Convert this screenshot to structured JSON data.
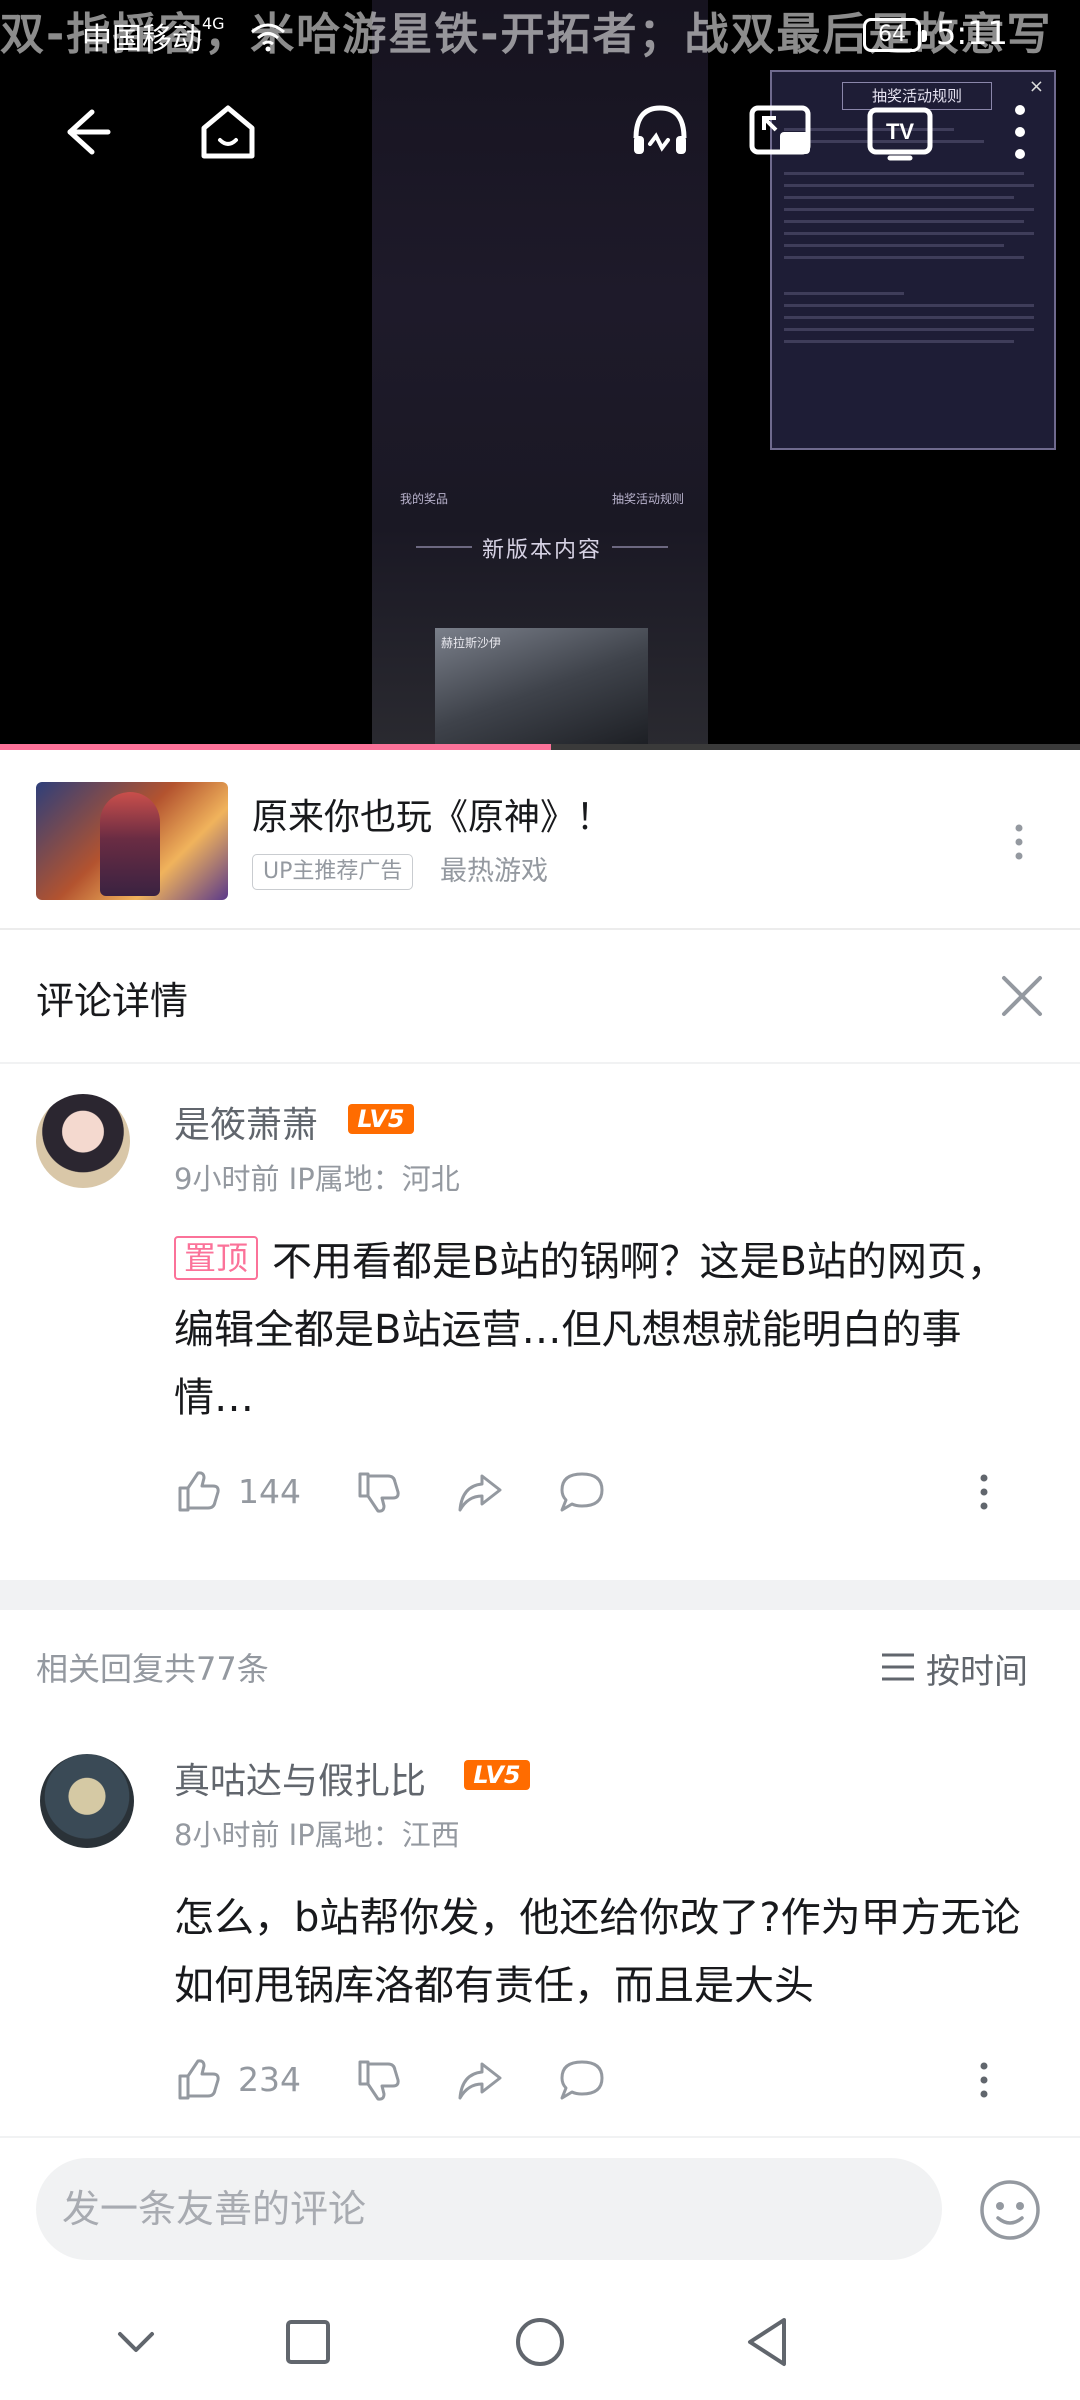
{
  "status_bar": {
    "marquee": "双-指摇容，米哈游星铁-开拓者；战双最后是故意写",
    "carrier": "中国移动",
    "network": "4G",
    "battery": "64",
    "time": "5:11"
  },
  "video": {
    "icons": [
      "back-icon",
      "home-icon",
      "audio-icon",
      "pip-icon",
      "tv-cast-icon",
      "more-icon"
    ],
    "frame": {
      "dialog_title": "抽奖活动规则",
      "my_prize_label": "我的奖品",
      "rules_label": "抽奖活动规则",
      "new_version_label": "新版本内容",
      "thumb_label": "赫拉斯沙伊"
    },
    "progress": 0.51
  },
  "ad": {
    "title": "原来你也玩《原神》！",
    "tag": "UP主推荐广告",
    "source": "最热游戏"
  },
  "comment_detail": {
    "title": "评论详情"
  },
  "main_comment": {
    "username": "是筱萧萧",
    "level": "LV5",
    "time": "9小时前",
    "ip": "IP属地：河北",
    "pinned_label": "置顶",
    "text": "不用看都是B站的锅啊？这是B站的网页，编辑全都是B站运营…但凡想想就能明白的事情…",
    "likes": "144"
  },
  "replies": {
    "header": "相关回复共77条",
    "sort_label": "按时间",
    "items": [
      {
        "username": "真咕达与假扎比",
        "level": "LV5",
        "time": "8小时前",
        "ip": "IP属地：江西",
        "text": "怎么，b站帮你发，他还给你改了?作为甲方无论如何甩锅库洛都有责任，而且是大头",
        "likes": "234"
      }
    ]
  },
  "input": {
    "placeholder": "发一条友善的评论"
  },
  "colors": {
    "accent": "#fb7299",
    "level": "#ff6c00",
    "text": "#18191c",
    "secondary": "#9499a0"
  }
}
